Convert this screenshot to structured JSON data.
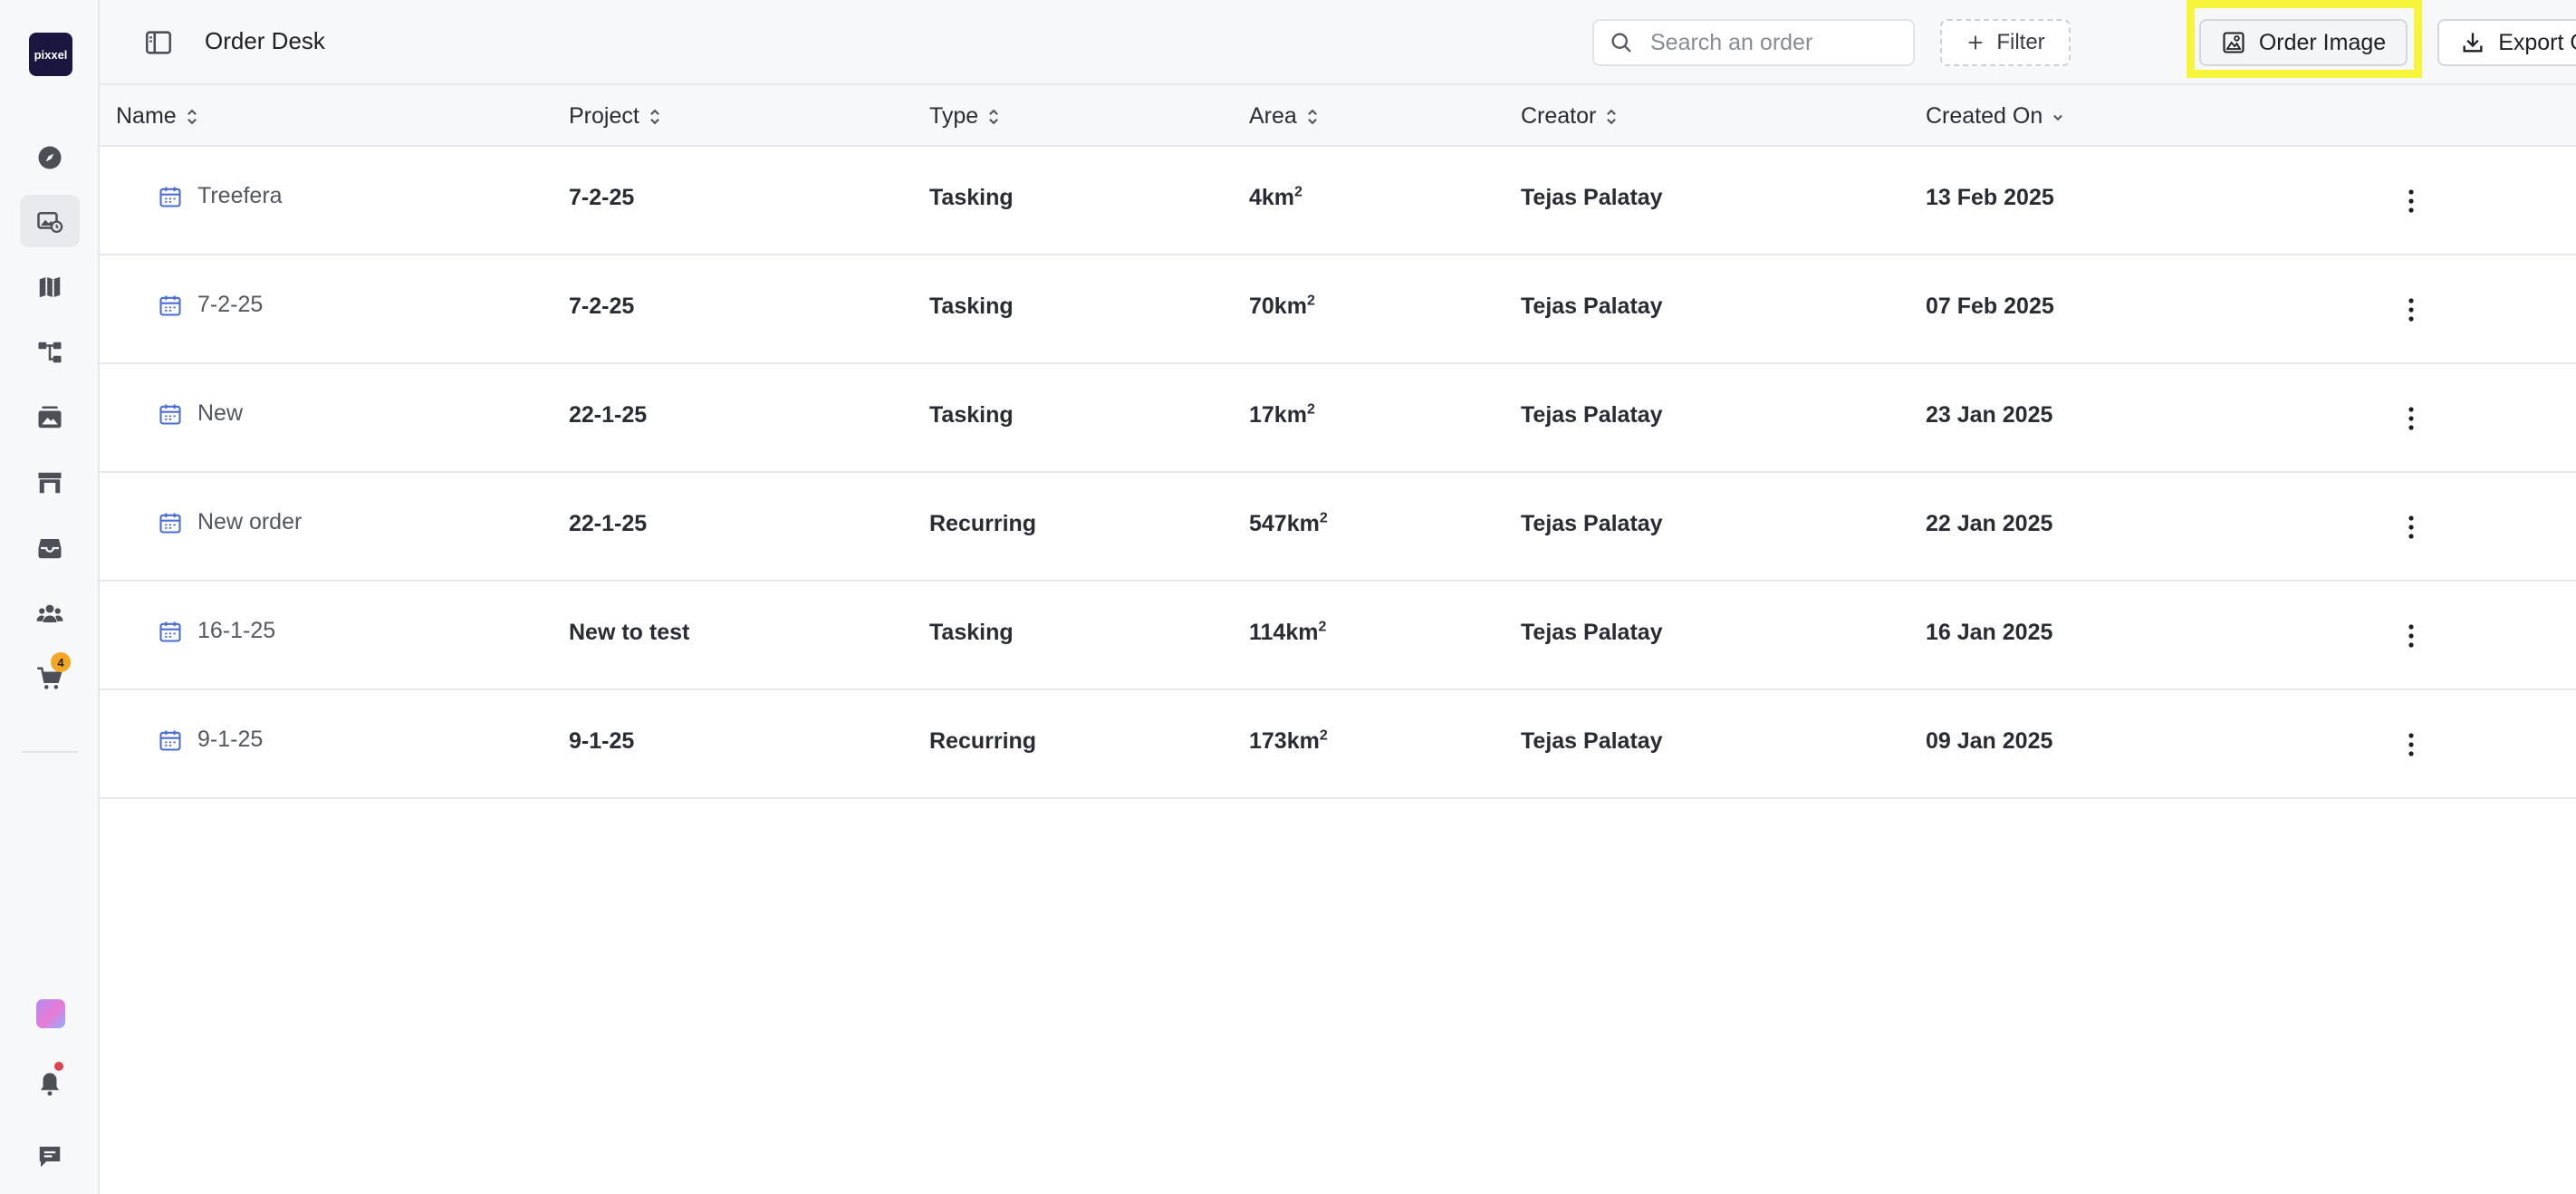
{
  "brand": {
    "logo_text": "pixxel"
  },
  "sidebar": {
    "items": [
      {
        "icon": "compass-icon",
        "label": "Explore",
        "active": false
      },
      {
        "icon": "image-order-icon",
        "label": "Order Desk",
        "active": true
      },
      {
        "icon": "map-icon",
        "label": "Maps",
        "active": false
      },
      {
        "icon": "workflow-icon",
        "label": "Workflows",
        "active": false
      },
      {
        "icon": "gallery-icon",
        "label": "Images",
        "active": false
      },
      {
        "icon": "store-icon",
        "label": "Store",
        "active": false
      },
      {
        "icon": "archive-icon",
        "label": "Archive",
        "active": false
      },
      {
        "icon": "team-icon",
        "label": "Team",
        "active": false
      },
      {
        "icon": "cart-icon",
        "label": "Cart",
        "active": false,
        "badge": "4"
      }
    ],
    "bottom": [
      {
        "icon": "gradient-app-icon"
      },
      {
        "icon": "bell-icon"
      },
      {
        "icon": "chat-icon"
      }
    ]
  },
  "header": {
    "title": "Order Desk",
    "search_placeholder": "Search an order",
    "filter_label": "Filter",
    "order_image_label": "Order Image",
    "export_label": "Export Orders"
  },
  "table": {
    "columns": [
      "Name",
      "Project",
      "Type",
      "Area",
      "Creator",
      "Created On"
    ],
    "area_superscript": "2",
    "rows": [
      {
        "name": "Treefera",
        "project": "7-2-25",
        "type": "Tasking",
        "area": "4km",
        "creator": "Tejas Palatay",
        "created_on": "13 Feb 2025"
      },
      {
        "name": "7-2-25",
        "project": "7-2-25",
        "type": "Tasking",
        "area": "70km",
        "creator": "Tejas Palatay",
        "created_on": "07 Feb 2025"
      },
      {
        "name": "New",
        "project": "22-1-25",
        "type": "Tasking",
        "area": "17km",
        "creator": "Tejas Palatay",
        "created_on": "23 Jan 2025"
      },
      {
        "name": "New order",
        "project": "22-1-25",
        "type": "Recurring",
        "area": "547km",
        "creator": "Tejas Palatay",
        "created_on": "22 Jan 2025"
      },
      {
        "name": "16-1-25",
        "project": "New to test",
        "type": "Tasking",
        "area": "114km",
        "creator": "Tejas Palatay",
        "created_on": "16 Jan 2025"
      },
      {
        "name": "9-1-25",
        "project": "9-1-25",
        "type": "Recurring",
        "area": "173km",
        "creator": "Tejas Palatay",
        "created_on": "09 Jan 2025"
      }
    ]
  },
  "colors": {
    "highlight": "#f6f53c",
    "logo_bg": "#1a1640",
    "badge": "#f5a623",
    "calendar_icon": "#4a6cd4",
    "notification_dot": "#e0424e"
  }
}
